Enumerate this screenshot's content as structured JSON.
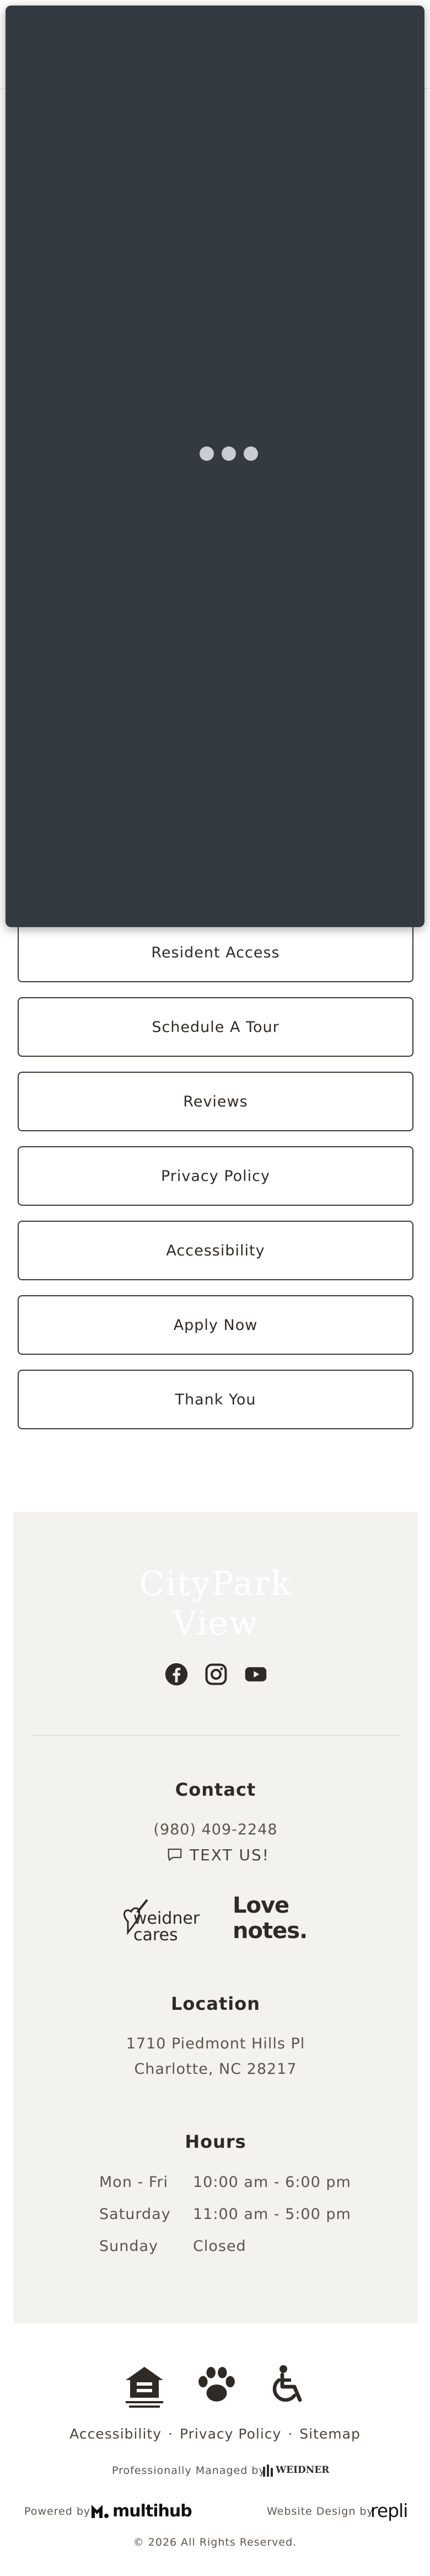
{
  "nav_links": [
    "Resident Access",
    "Schedule A Tour",
    "Reviews",
    "Privacy Policy",
    "Accessibility",
    "Apply Now",
    "Thank You"
  ],
  "footer": {
    "logo_line1": "CityPark",
    "logo_line2": "View",
    "social_icons": [
      "facebook-icon",
      "instagram-icon",
      "youtube-icon"
    ],
    "contact": {
      "title": "Contact",
      "phone": "(980) 409-2248",
      "text_us": "TEXT US!"
    },
    "brands": {
      "weidner_cares": "weidner cares",
      "love_notes_1": "Love",
      "love_notes_2": "notes."
    },
    "location": {
      "title": "Location",
      "address1": "1710 Piedmont Hills Pl",
      "address2": "Charlotte, NC 28217"
    },
    "hours": {
      "title": "Hours",
      "rows": [
        {
          "day": "Mon - Fri",
          "time": "10:00 am - 6:00 pm"
        },
        {
          "day": "Saturday",
          "time": "11:00 am - 5:00 pm"
        },
        {
          "day": "Sunday",
          "time": "Closed"
        }
      ]
    }
  },
  "bottom": {
    "links": [
      "Accessibility",
      "Privacy Policy",
      "Sitemap"
    ],
    "separator": "·",
    "managed_by": "Professionally Managed by",
    "weidner_logo": "WEIDNER",
    "powered_by": "Powered by",
    "multihub": "multihub",
    "website_design_by": "Website Design by",
    "repli": "repli",
    "copyright": "© 2026 All Rights Reserved."
  },
  "colors": {
    "modal_bg": "#343a42",
    "footer_bg": "#f3f2ee",
    "text": "#2f2a25"
  }
}
